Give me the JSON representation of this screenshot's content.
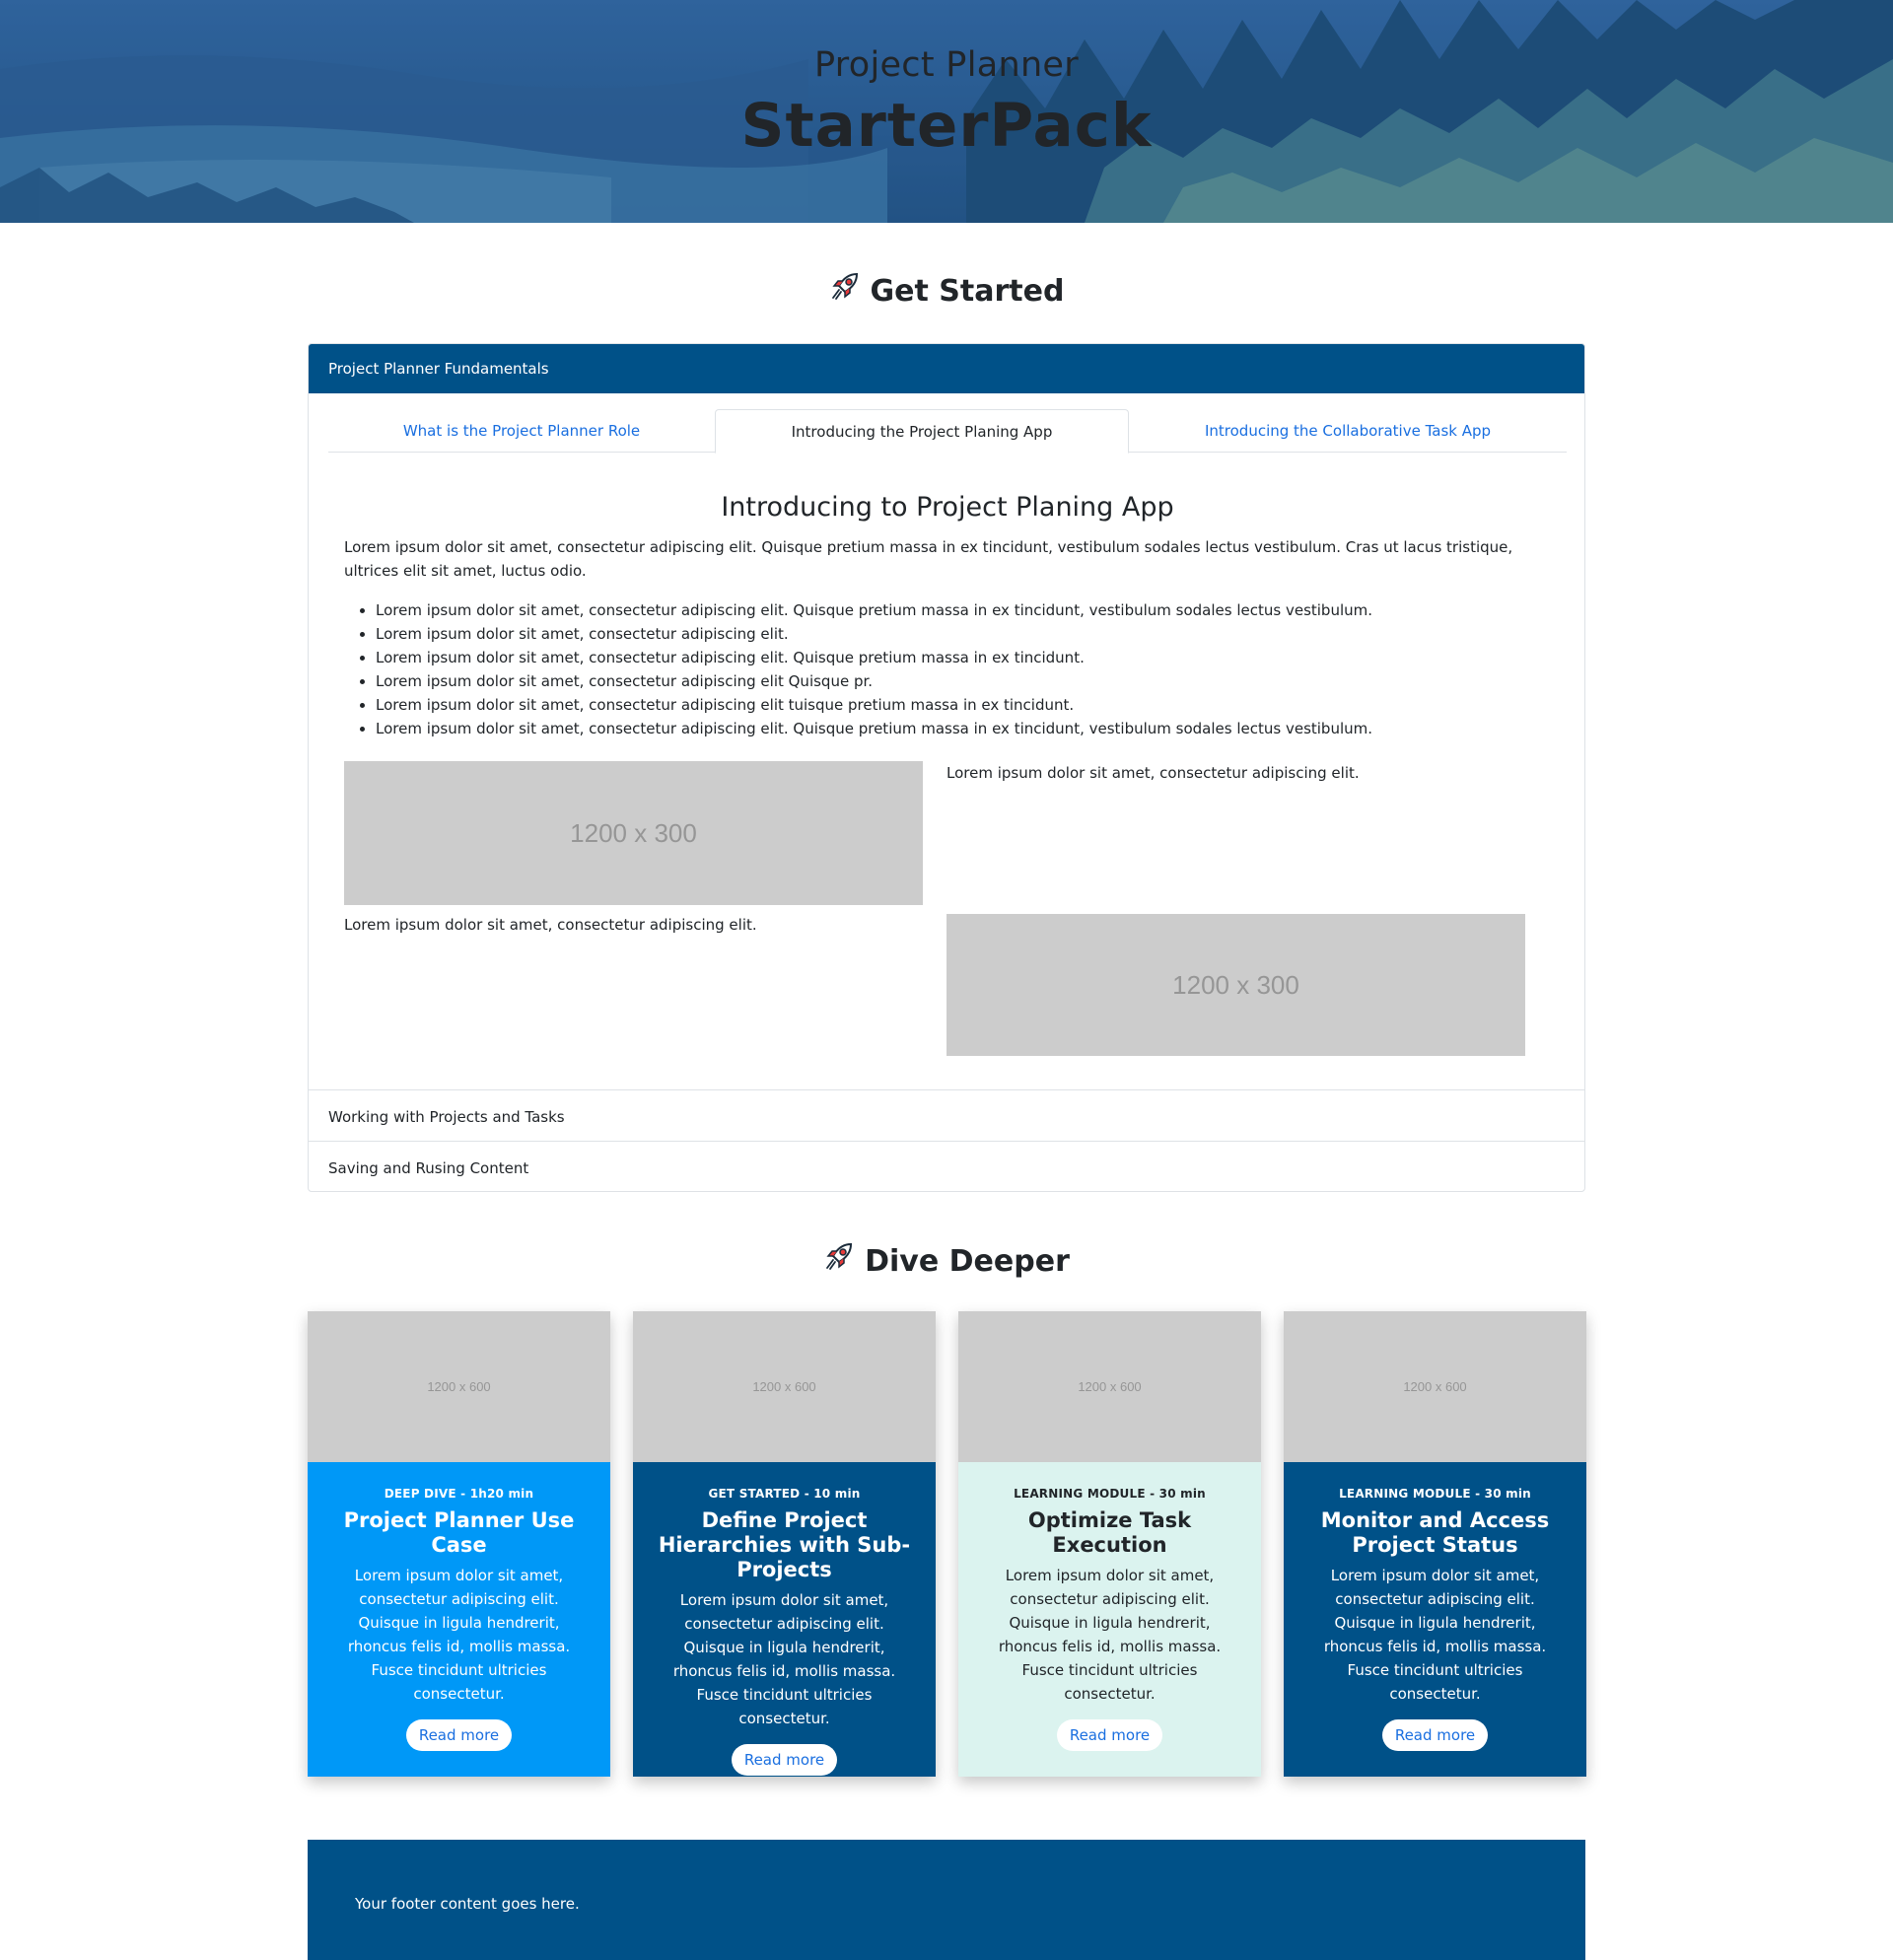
{
  "hero": {
    "subtitle": "Project Planner",
    "title": "StarterPack"
  },
  "get_started": {
    "heading": "Get Started",
    "icon": "rocket-icon",
    "accordion": {
      "active_section": "Project Planner Fundamentals",
      "tabs": [
        {
          "label": "What is the Project Planner Role",
          "active": false
        },
        {
          "label": "Introducing the Project Planing App",
          "active": true
        },
        {
          "label": "Introducing the Collaborative Task App",
          "active": false
        }
      ],
      "pane": {
        "title": "Introducing to Project Planing App",
        "intro": "Lorem ipsum dolor sit amet, consectetur adipiscing elit. Quisque pretium massa in ex tincidunt, vestibulum sodales lectus vestibulum. Cras ut lacus tristique, ultrices elit sit amet, luctus odio.",
        "bullets": [
          "Lorem ipsum dolor sit amet, consectetur adipiscing elit. Quisque pretium massa in ex tincidunt, vestibulum sodales lectus vestibulum.",
          "Lorem ipsum dolor sit amet, consectetur adipiscing elit.",
          "Lorem ipsum dolor sit amet, consectetur adipiscing elit. Quisque pretium massa in ex tincidunt.",
          "Lorem ipsum dolor sit amet, consectetur adipiscing elit Quisque pr.",
          "Lorem ipsum dolor sit amet, consectetur adipiscing elit tuisque pretium massa in ex tincidunt.",
          "Lorem ipsum dolor sit amet, consectetur adipiscing elit. Quisque pretium massa in ex tincidunt, vestibulum sodales lectus vestibulum."
        ],
        "image_label_1": "1200 x 300",
        "side_text_1": "Lorem ipsum dolor sit amet, consectetur adipiscing elit.",
        "side_text_2": "Lorem ipsum dolor sit amet, consectetur adipiscing elit.",
        "image_label_2": "1200 x 300"
      },
      "collapsed_sections": [
        "Working with Projects and Tasks",
        "Saving and Rusing Content"
      ]
    }
  },
  "dive_deeper": {
    "heading": "Dive Deeper",
    "icon": "rocket-icon",
    "cards": [
      {
        "image_label": "1200 x 600",
        "kicker": "DEEP DIVE - 1h20 min",
        "title": "Project Planner Use Case",
        "text": "Lorem ipsum dolor sit amet, consectetur adipiscing elit. Quisque in ligula hendrerit, rhoncus felis id, mollis massa. Fusce tincidunt ultricies consectetur.",
        "button": "Read more",
        "color": "#0098f7"
      },
      {
        "image_label": "1200 x 600",
        "kicker": "GET STARTED - 10 min",
        "title": "Define Project Hierarchies with Sub-Projects",
        "text": "Lorem ipsum dolor sit amet, consectetur adipiscing elit. Quisque in ligula hendrerit, rhoncus felis id, mollis massa. Fusce tincidunt ultricies consectetur.",
        "button": "Read more",
        "color": "#005188"
      },
      {
        "image_label": "1200 x 600",
        "kicker": "LEARNING MODULE - 30 min",
        "title": "Optimize Task Execution",
        "text": "Lorem ipsum dolor sit amet, consectetur adipiscing elit. Quisque in ligula hendrerit, rhoncus felis id, mollis massa. Fusce tincidunt ultricies consectetur.",
        "button": "Read more",
        "color": "#dbf3ef"
      },
      {
        "image_label": "1200 x 600",
        "kicker": "LEARNING MODULE - 30 min",
        "title": "Monitor and Access Project Status",
        "text": "Lorem ipsum dolor sit amet, consectetur adipiscing elit. Quisque in ligula hendrerit, rhoncus felis id, mollis massa. Fusce tincidunt ultricies consectetur.",
        "button": "Read more",
        "color": "#005188"
      }
    ]
  },
  "footer": {
    "text": "Your footer content goes here."
  },
  "colors": {
    "primary_navy": "#005188",
    "accent_blue": "#0098f7",
    "mint": "#dbf3ef",
    "link": "#1a6fe0",
    "placeholder": "#cccccc"
  }
}
